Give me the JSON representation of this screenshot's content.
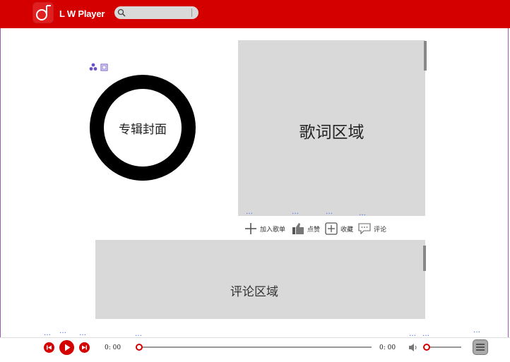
{
  "colors": {
    "brand": "#d40000",
    "panel": "#d9d9d9",
    "text": "#222222",
    "accent_dots": "#4a6cf7"
  },
  "header": {
    "app_name": "L W Player",
    "logo_icon": "music-note-icon",
    "search": {
      "placeholder": "",
      "value": "",
      "caption": "… ···",
      "icon": "search-icon"
    }
  },
  "album": {
    "label": "专辑封面",
    "cluster_icon": "cluster-icon",
    "pic_icon": "image-icon"
  },
  "lyrics": {
    "label": "歌词区域"
  },
  "actions": [
    {
      "label": "加入歌单",
      "icon": "plus-icon"
    },
    {
      "label": "点赞",
      "icon": "thumbs-up-icon"
    },
    {
      "label": "收藏",
      "icon": "bookmark-plus-icon"
    },
    {
      "label": "评论",
      "icon": "comment-icon"
    }
  ],
  "comments": {
    "label": "评论区域"
  },
  "player": {
    "current_time": "0: 00",
    "total_time": "0: 00",
    "progress": 0,
    "volume": 0,
    "prev_icon": "skip-back-icon",
    "play_icon": "play-icon",
    "next_icon": "skip-forward-icon",
    "volume_icon": "speaker-icon",
    "menu_icon": "menu-icon"
  },
  "annotation_dots": "…"
}
